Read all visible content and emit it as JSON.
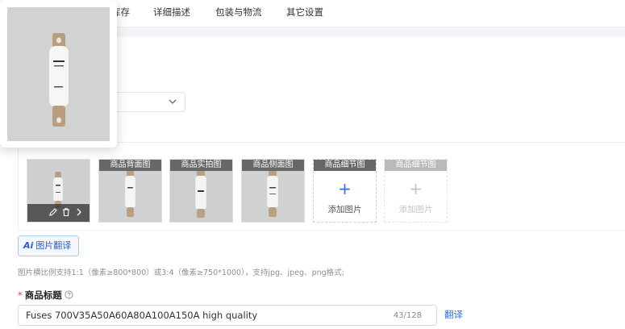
{
  "tabs": [
    {
      "label": "库存"
    },
    {
      "label": "详细描述"
    },
    {
      "label": "包装与物流"
    },
    {
      "label": "其它设置"
    }
  ],
  "images": {
    "thumbnails": [
      {
        "label": "",
        "kind": "main"
      },
      {
        "label": "商品背面图"
      },
      {
        "label": "商品实拍图"
      },
      {
        "label": "商品侧面图"
      }
    ],
    "add_slots": [
      {
        "label": "商品细节图",
        "add_text": "添加图片",
        "enabled": true
      },
      {
        "label": "商品细节图",
        "add_text": "添加图片",
        "enabled": false
      }
    ],
    "ai_button_ai": "Ai",
    "ai_button_label": "图片翻译",
    "hint": "图片横比例支持1:1（像素≥800*800）或3:4（像素≥750*1000），支持jpg、jpeg、png格式;"
  },
  "title_field": {
    "label": "商品标题",
    "required_mark": "*",
    "value": "Fuses 700V35A50A60A80A100A150A high quality",
    "count": "43/128",
    "translate_label": "翻译"
  },
  "colors": {
    "accent": "#2f6fde",
    "required": "#e2452f"
  }
}
